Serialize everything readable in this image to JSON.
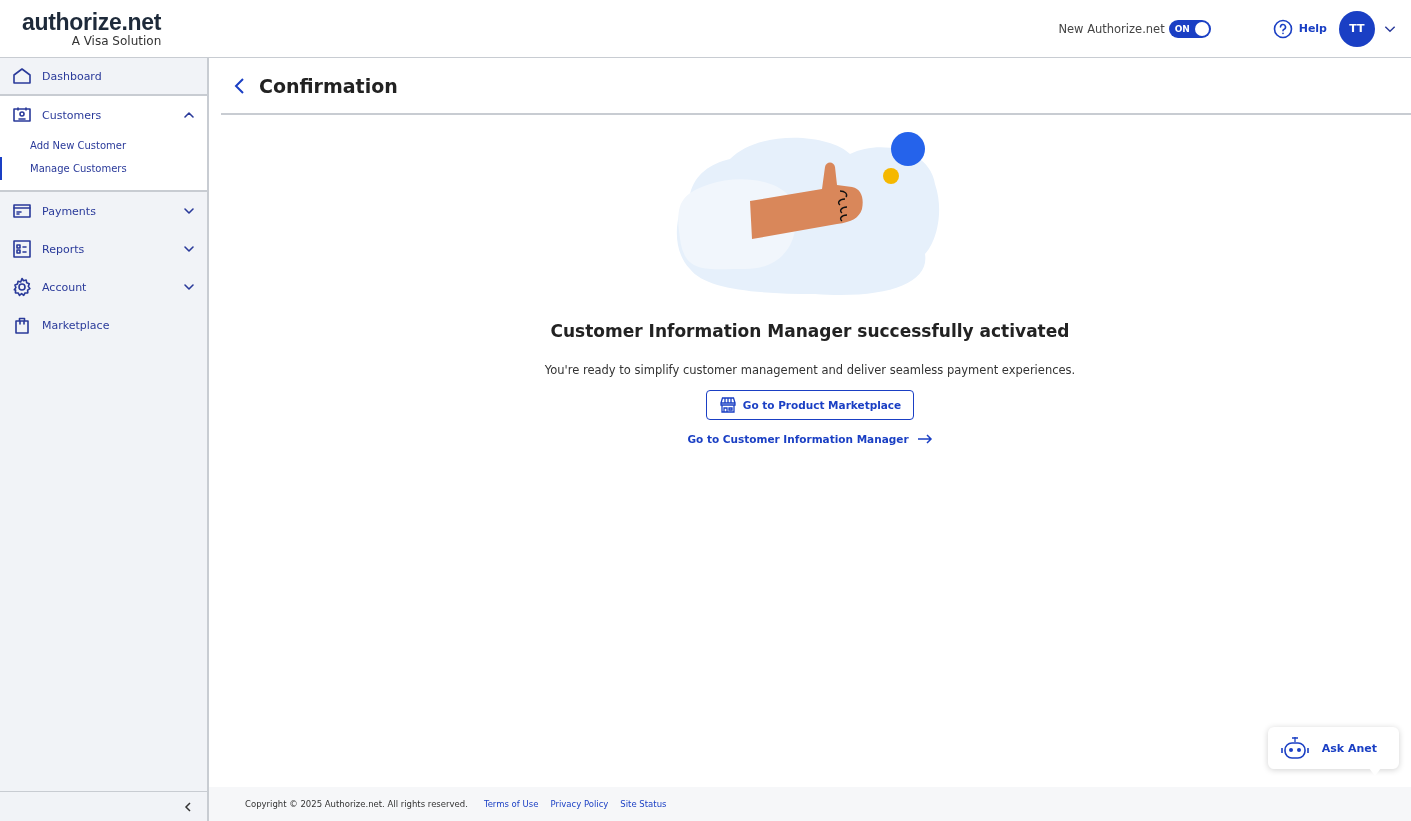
{
  "header": {
    "logo": "authorize.net",
    "logo_tagline": "A Visa Solution",
    "toggle": {
      "label": "New Authorize.net",
      "text": "ON",
      "on": true
    },
    "help": "Help",
    "avatar": "TT"
  },
  "sidebar": {
    "items": [
      {
        "label": "Dashboard"
      },
      {
        "label": "Customers",
        "expanded": true,
        "children": [
          {
            "label": "Add New Customer",
            "selected": false
          },
          {
            "label": "Manage Customers",
            "selected": true
          }
        ]
      },
      {
        "label": "Payments",
        "expanded": false
      },
      {
        "label": "Reports",
        "expanded": false
      },
      {
        "label": "Account",
        "expanded": false
      },
      {
        "label": "Marketplace"
      }
    ]
  },
  "page": {
    "title": "Confirmation",
    "heading": "Customer Information Manager successfully activated",
    "message": "You're ready to simplify customer management and deliver seamless payment experiences.",
    "primary_button": "Go to Product Marketplace",
    "link": "Go to Customer Information Manager"
  },
  "chat": {
    "label": "Ask Anet"
  },
  "footer": {
    "copyright": "Copyright © 2025 Authorize.net. All rights reserved.",
    "links": [
      "Terms of Use",
      "Privacy Policy",
      "Site Status"
    ]
  }
}
